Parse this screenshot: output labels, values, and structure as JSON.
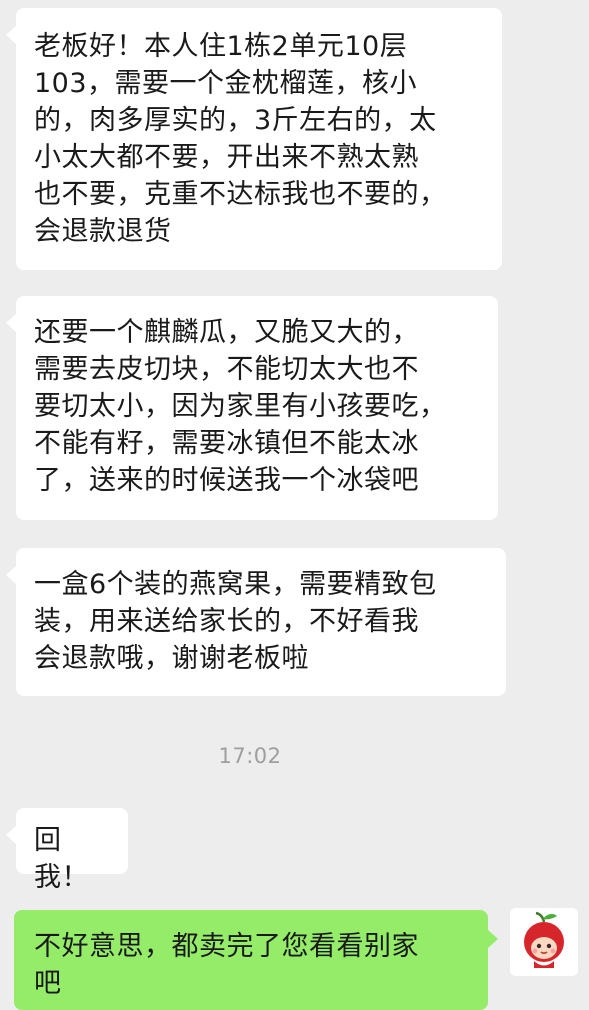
{
  "chat": {
    "messages": [
      {
        "direction": "incoming",
        "lines": [
          "老板好！本人住1栋2单元10层",
          "103，需要一个金枕榴莲，核小",
          "的，肉多厚实的，3斤左右的，太",
          "小太大都不要，开出来不熟太熟",
          "也不要，克重不达标我也不要的，",
          "会退款退货"
        ]
      },
      {
        "direction": "incoming",
        "lines": [
          "还要一个麒麟瓜，又脆又大的，",
          "需要去皮切块，不能切太大也不",
          "要切太小，因为家里有小孩要吃，",
          "不能有籽，需要冰镇但不能太冰",
          "了，送来的时候送我一个冰袋吧"
        ]
      },
      {
        "direction": "incoming",
        "lines": [
          "一盒6个装的燕窝果，需要精致包",
          "装，用来送给家长的，不好看我",
          "会退款哦，谢谢老板啦"
        ]
      }
    ],
    "timestamp": "17:02",
    "reply_prompt": {
      "direction": "incoming",
      "text": "回我！"
    },
    "outgoing": {
      "direction": "outgoing",
      "lines": [
        "不好意思，都卖完了您看看别家",
        "吧"
      ],
      "avatar_icon": "cherry-character-avatar-icon"
    }
  },
  "colors": {
    "background": "#ededed",
    "incoming_bubble": "#ffffff",
    "outgoing_bubble": "#95ec69",
    "timestamp": "#9e9e9e",
    "avatar_red": "#d7262b"
  }
}
